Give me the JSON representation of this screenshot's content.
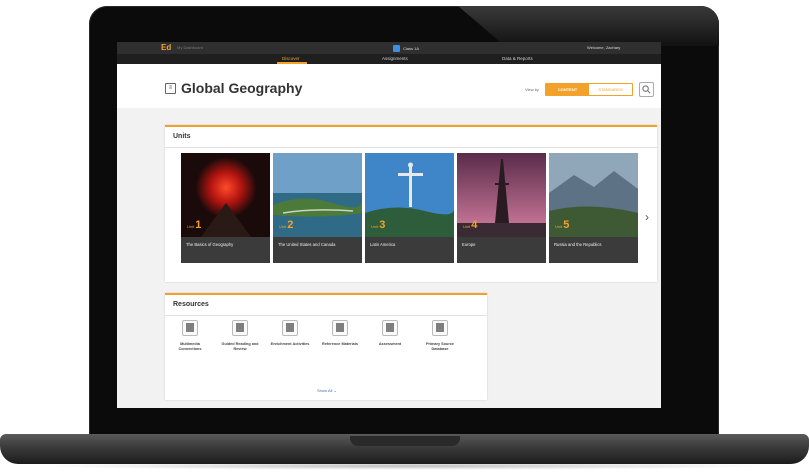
{
  "topbar": {
    "logo": "Ed",
    "logo_sub": "My Dashboard",
    "class_label": "Class 1A",
    "welcome": "Welcome, Zachary"
  },
  "nav": {
    "items": [
      {
        "label": "Discover",
        "active": true
      },
      {
        "label": "Assignments",
        "active": false
      },
      {
        "label": "Data & Reports",
        "active": false
      }
    ]
  },
  "header": {
    "title": "Global Geography",
    "view_by": "View by",
    "toggle_content": "CONTENT",
    "toggle_standards": "STANDARDS"
  },
  "units": {
    "title": "Units",
    "items": [
      {
        "unit_label": "Unit",
        "number": "1",
        "title": "The Basics of Geography"
      },
      {
        "unit_label": "Unit",
        "number": "2",
        "title": "The United States and Canada"
      },
      {
        "unit_label": "Unit",
        "number": "3",
        "title": "Latin America"
      },
      {
        "unit_label": "Unit",
        "number": "4",
        "title": "Europe"
      },
      {
        "unit_label": "Unit",
        "number": "5",
        "title": "Russia and the Republics"
      }
    ]
  },
  "resources": {
    "title": "Resources",
    "items": [
      {
        "label": "Multimedia Connections"
      },
      {
        "label": "Guided Reading and Review"
      },
      {
        "label": "Enrichment Activities"
      },
      {
        "label": "Reference Materials"
      },
      {
        "label": "Assessment"
      },
      {
        "label": "Primary Source Database"
      }
    ],
    "show_all": "Show All"
  },
  "colors": {
    "accent": "#f2a22a",
    "topbar": "#2f2f2f",
    "navbar": "#1f1f1f"
  }
}
